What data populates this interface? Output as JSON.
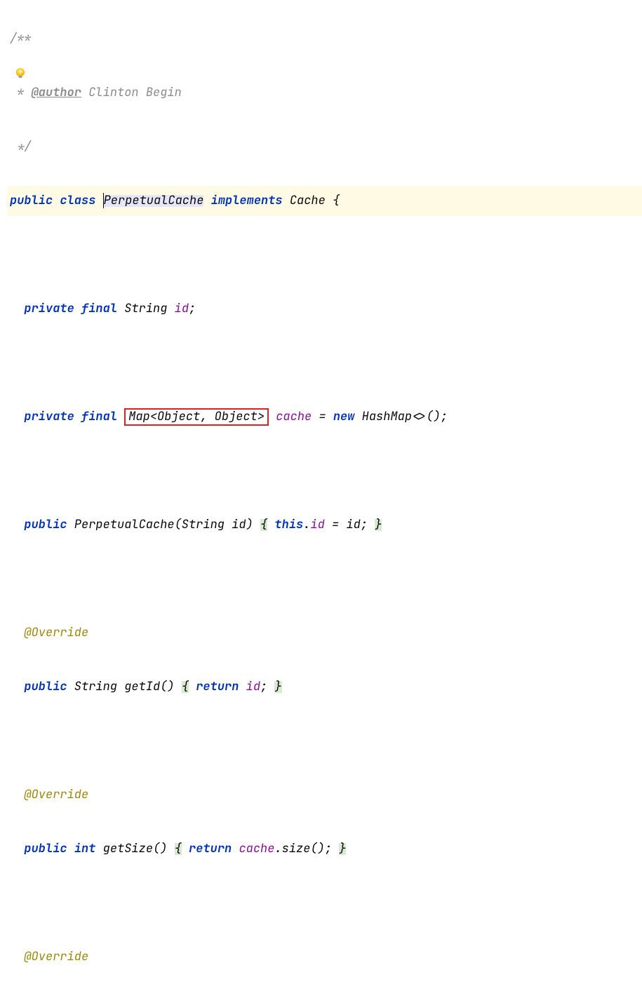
{
  "doc": {
    "open": "/**",
    "tag": "@author",
    "author": "Clinton Begin",
    "close": "*/",
    "star": " * "
  },
  "decl": {
    "public": "public",
    "class": "class",
    "name": "PerpetualCache",
    "implements": "implements",
    "iface": "Cache",
    "open": "{"
  },
  "f1": {
    "private": "private",
    "final": "final",
    "type": "String",
    "name": "id",
    "semi": ";"
  },
  "f2": {
    "private": "private",
    "final": "final",
    "type": "Map<Object, Object>",
    "name": "cache",
    "eq": " = ",
    "new": "new",
    "ctor": " HashMap<>();"
  },
  "ctor": {
    "public": "public",
    "sig": " PerpetualCache(String id) ",
    "open": "{",
    "this": "this",
    "dot": ".",
    "field": "id",
    "assign": " = id; ",
    "close": "}"
  },
  "override": "@Override",
  "m1": {
    "public": "public",
    "ret": " String getId() ",
    "open": "{",
    "return": "return",
    "field": "id",
    "semi": "; ",
    "close": "}"
  },
  "m2": {
    "public": "public",
    "int": "int",
    "sig": " getSize() ",
    "open": "{",
    "return": "return",
    "field": "cache",
    "call": ".size(); ",
    "close": "}"
  }
}
